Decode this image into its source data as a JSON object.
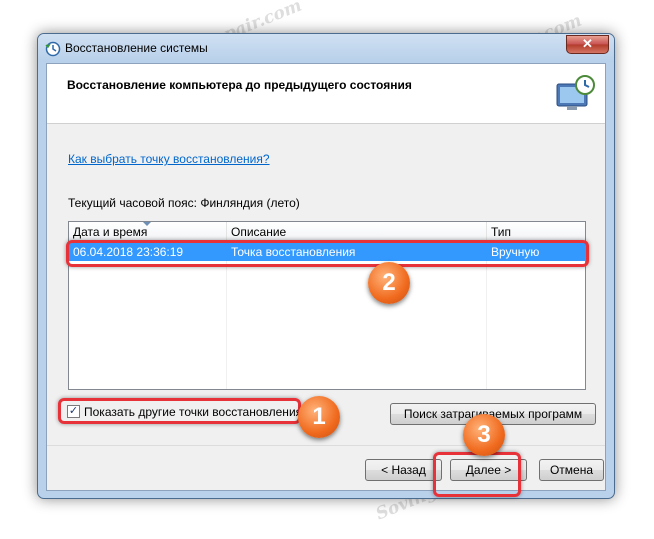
{
  "window": {
    "title": "Восстановление системы",
    "header_title": "Восстановление компьютера до предыдущего состояния",
    "close_label": "✕"
  },
  "help_link": "Как выбрать точку восстановления?",
  "timezone_label": "Текущий часовой пояс: Финляндия (лето)",
  "table": {
    "columns": [
      "Дата и время",
      "Описание",
      "Тип"
    ],
    "rows": [
      {
        "date": "06.04.2018 23:36:19",
        "description": "Точка восстановления",
        "type": "Вручную",
        "selected": true
      }
    ]
  },
  "checkbox": {
    "label": "Показать другие точки восстановления",
    "checked": true,
    "mark": "✓"
  },
  "buttons": {
    "affected": "Поиск затрагиваемых программ",
    "back": "< Назад",
    "next": "Далее >",
    "cancel": "Отмена"
  },
  "badges": [
    "1",
    "2",
    "3"
  ],
  "watermark": "Sovingpsrepair.com",
  "colors": {
    "selection": "#3399ff",
    "highlight": "#e8323a",
    "badge": "#f06a1e",
    "link": "#0066cc"
  }
}
